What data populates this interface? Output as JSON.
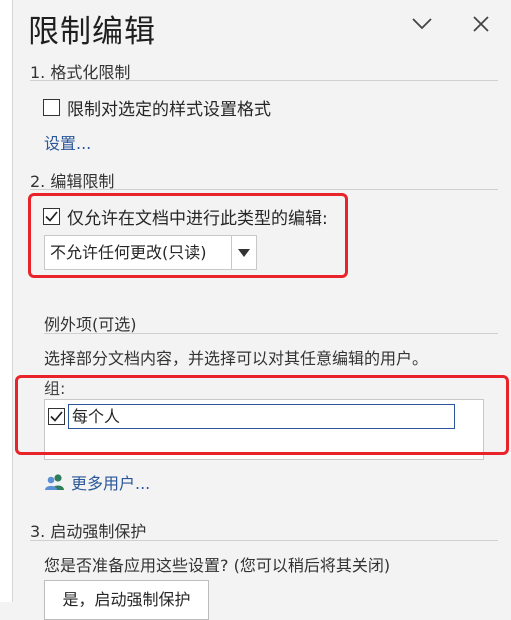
{
  "pane": {
    "title": "限制编辑"
  },
  "section1": {
    "heading": "1. 格式化限制",
    "checkbox_label": "限制对选定的样式设置格式",
    "checkbox_checked": false,
    "settings_link": "设置..."
  },
  "section2": {
    "heading": "2. 编辑限制",
    "checkbox_label": "仅允许在文档中进行此类型的编辑:",
    "checkbox_checked": true,
    "edit_type_selected": "不允许任何更改(只读)"
  },
  "exceptions": {
    "heading": "例外项(可选)",
    "instruction": "选择部分文档内容，并选择可以对其任意编辑的用户。",
    "groups_label": "组:",
    "groups": [
      {
        "name": "每个人",
        "checked": true
      }
    ],
    "more_users_link": "更多用户..."
  },
  "section3": {
    "heading": "3. 启动强制保护",
    "question": "您是否准备应用这些设置? (您可以稍后将其关闭)",
    "start_button": "是，启动强制保护"
  },
  "colors": {
    "accent": "#2b579a",
    "annotation_red": "#e8242a",
    "pane_bg": "#f3f3f3"
  }
}
